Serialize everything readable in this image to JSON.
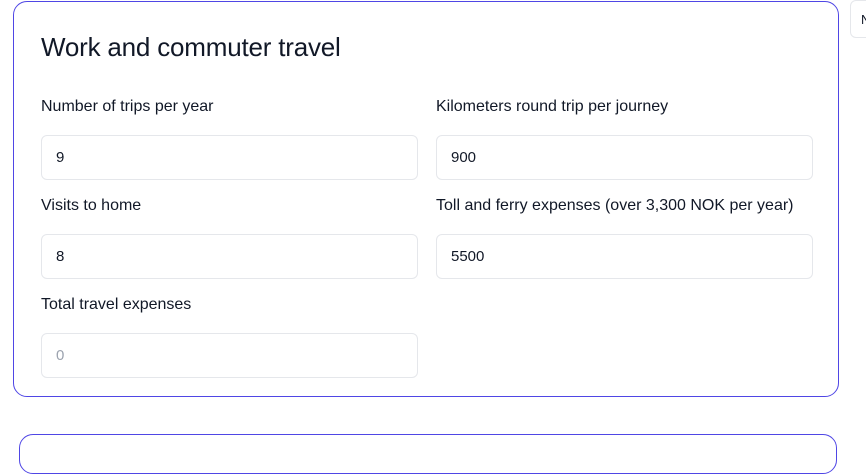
{
  "section": {
    "title": "Work and commuter travel",
    "fields": {
      "trips_per_year": {
        "label": "Number of trips per year",
        "value": "9"
      },
      "km_round_trip": {
        "label": "Kilometers round trip per journey",
        "value": "900"
      },
      "visits_home": {
        "label": "Visits to home",
        "value": "8"
      },
      "toll_ferry": {
        "label": "Toll and ferry expenses (over 3,300 NOK per year)",
        "value": "5500"
      },
      "total_expenses": {
        "label": "Total travel expenses",
        "value": "0"
      }
    }
  },
  "side_button": {
    "label": "N"
  },
  "colors": {
    "card_border": "#4f46e5",
    "input_border": "#e5e7eb",
    "text": "#111827",
    "muted": "#9ca3af"
  }
}
